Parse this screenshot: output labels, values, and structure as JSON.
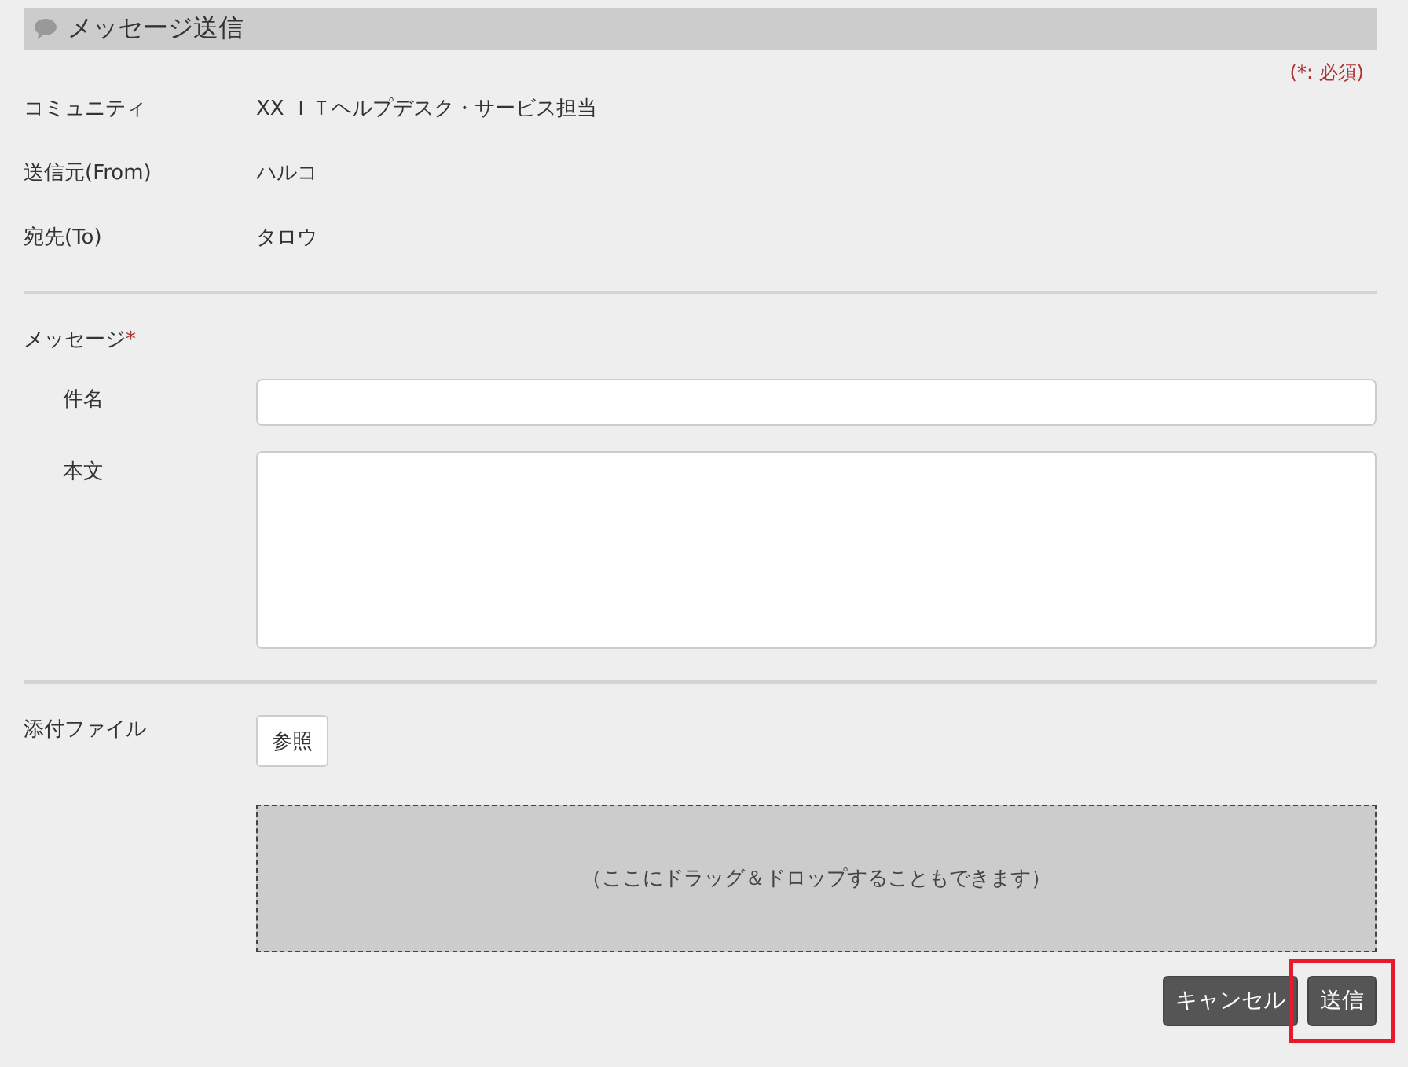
{
  "header": {
    "title": "メッセージ送信"
  },
  "required_note": "(*: 必須)",
  "info_rows": [
    {
      "label": "コミュニティ",
      "value": "XX ＩＴヘルプデスク・サービス担当"
    },
    {
      "label": "送信元(From)",
      "value": "ハルコ"
    },
    {
      "label": "宛先(To)",
      "value": "タロウ"
    }
  ],
  "message": {
    "label": "メッセージ",
    "required_mark": "*",
    "subject_label": "件名",
    "body_label": "本文"
  },
  "attachment": {
    "label": "添付ファイル",
    "browse_button": "参照",
    "drop_hint": "（ここにドラッグ＆ドロップすることもできます）"
  },
  "buttons": [
    {
      "label": "キャンセル",
      "highlighted": false
    },
    {
      "label": "送信",
      "highlighted": true
    }
  ]
}
